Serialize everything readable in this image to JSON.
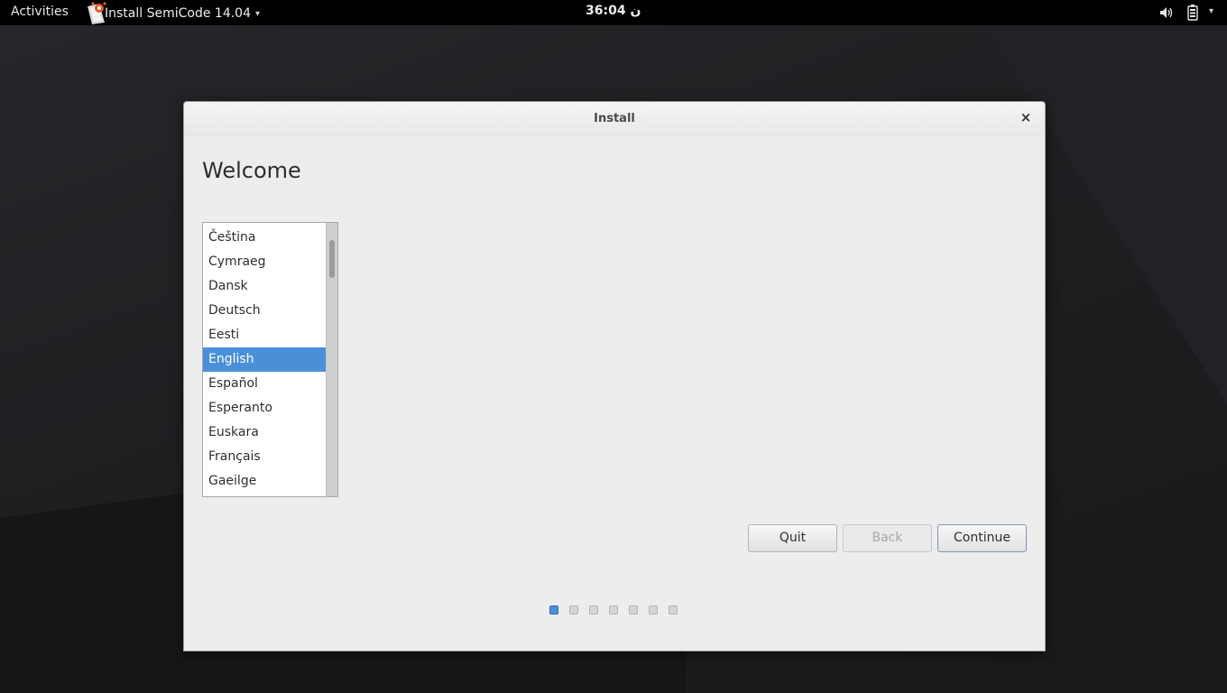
{
  "top_panel": {
    "activities_label": "Activities",
    "app_menu_label": "Install SemiCode 14.04",
    "app_menu_caret": "▾",
    "clock": "36:04 ن",
    "tray_caret": "▾",
    "icons": [
      "installer-app-icon",
      "volume-icon",
      "battery-icon"
    ]
  },
  "window": {
    "title": "Install",
    "close_glyph": "×",
    "heading": "Welcome",
    "languages": [
      {
        "label": "Čeština",
        "selected": false
      },
      {
        "label": "Cymraeg",
        "selected": false
      },
      {
        "label": "Dansk",
        "selected": false
      },
      {
        "label": "Deutsch",
        "selected": false
      },
      {
        "label": "Eesti",
        "selected": false
      },
      {
        "label": "English",
        "selected": true
      },
      {
        "label": "Español",
        "selected": false
      },
      {
        "label": "Esperanto",
        "selected": false
      },
      {
        "label": "Euskara",
        "selected": false
      },
      {
        "label": "Français",
        "selected": false
      },
      {
        "label": "Gaeilge",
        "selected": false
      }
    ],
    "buttons": {
      "quit": "Quit",
      "back": "Back",
      "continue": "Continue"
    },
    "steps": {
      "total": 7,
      "current": 1
    }
  },
  "colors": {
    "accent": "#4a90d9",
    "panel_bg": "#000000",
    "window_bg": "#ededed"
  }
}
